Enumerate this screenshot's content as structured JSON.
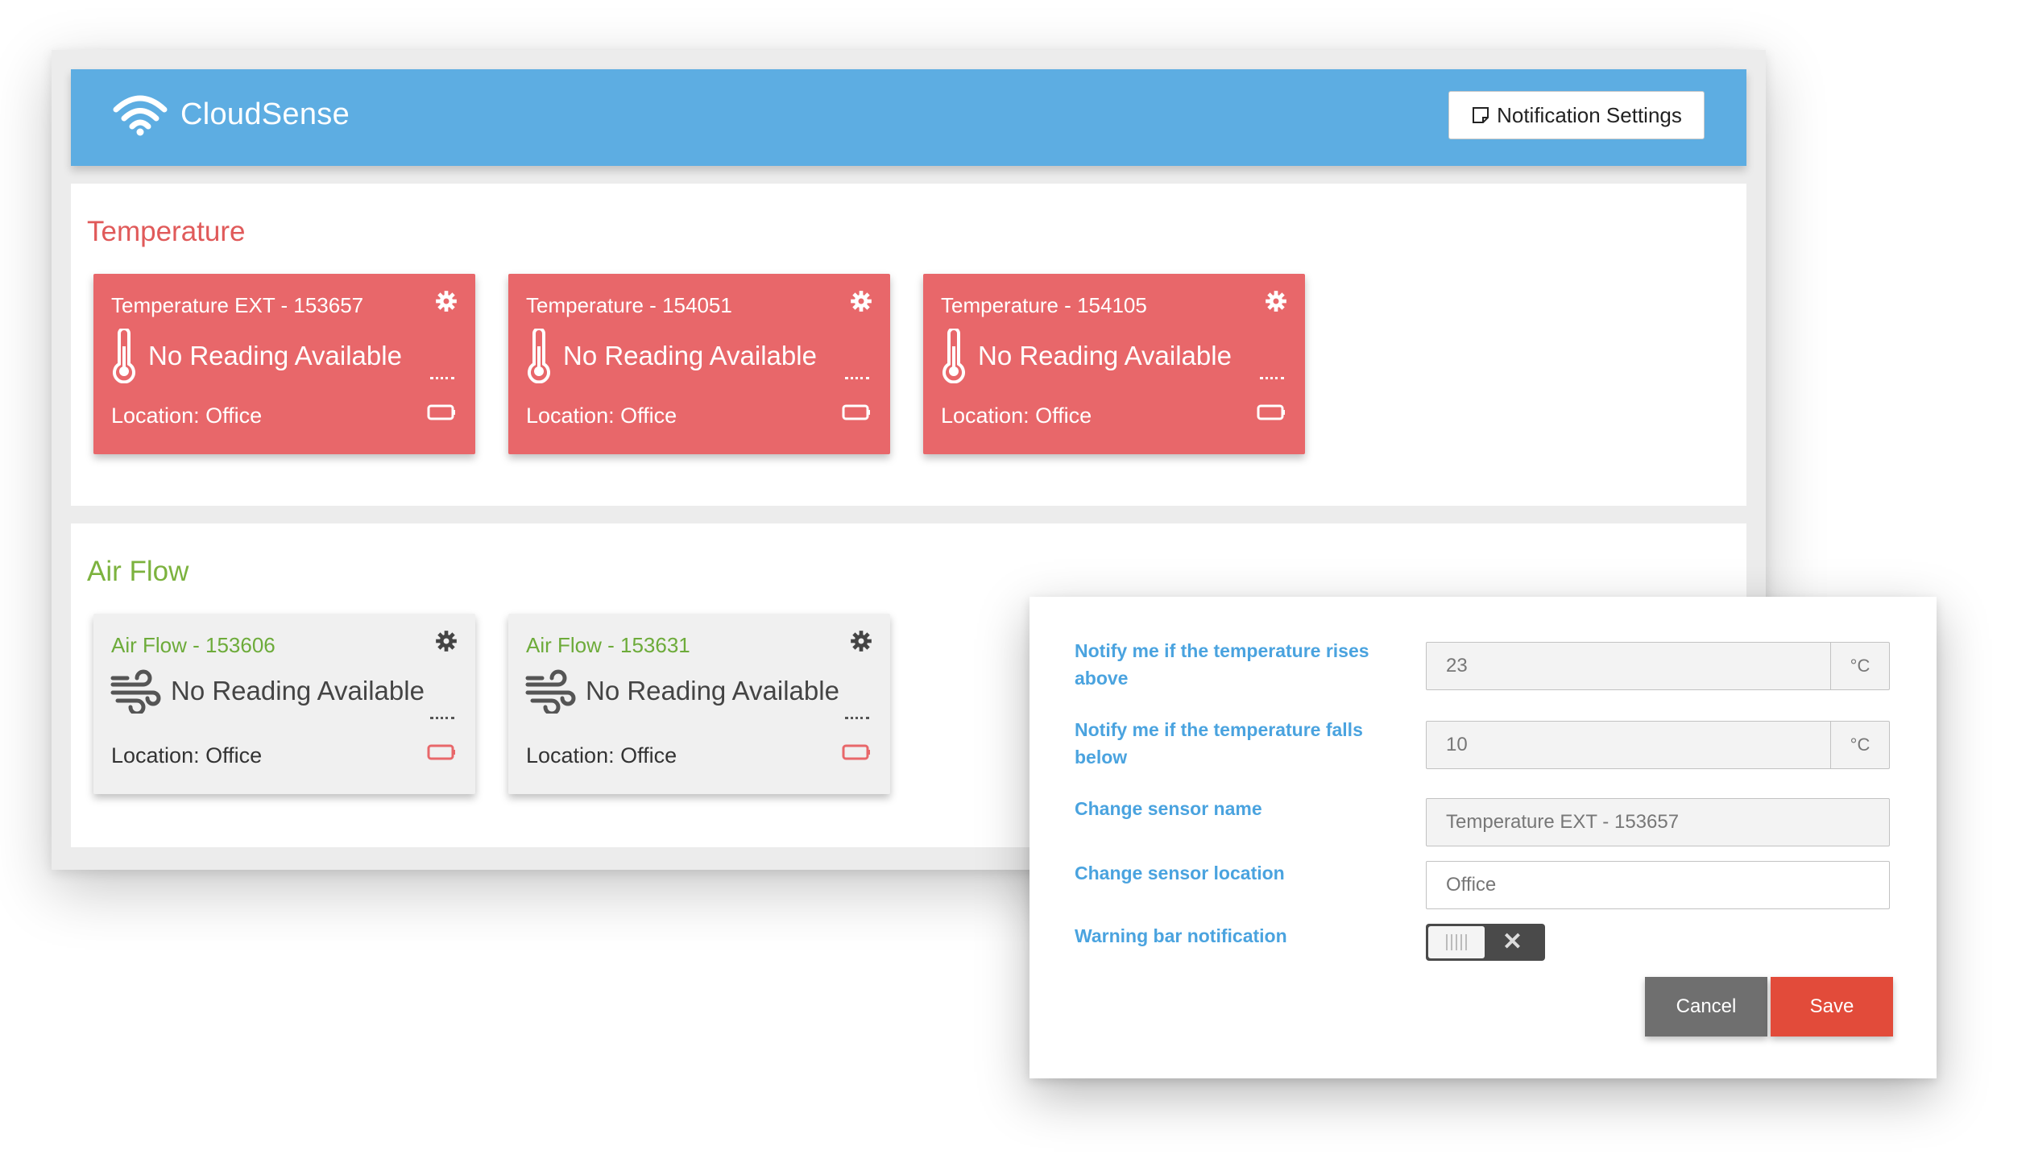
{
  "app": {
    "brand": "CloudSense",
    "notification_button": "Notification Settings"
  },
  "sections": {
    "temperature": {
      "title": "Temperature",
      "color": "#e05a5a",
      "cards": [
        {
          "title": "Temperature EXT - 153657",
          "reading": "No Reading Available",
          "location": "Location: Office"
        },
        {
          "title": "Temperature - 154051",
          "reading": "No Reading Available",
          "location": "Location: Office"
        },
        {
          "title": "Temperature - 154105",
          "reading": "No Reading Available",
          "location": "Location: Office"
        }
      ]
    },
    "airflow": {
      "title": "Air Flow",
      "color": "#7cb23e",
      "cards": [
        {
          "title": "Air Flow - 153606",
          "reading": "No Reading Available",
          "location": "Location: Office"
        },
        {
          "title": "Air Flow - 153631",
          "reading": "No Reading Available",
          "location": "Location: Office"
        }
      ]
    }
  },
  "dialog": {
    "rise_label": "Notify me if the temperature rises above",
    "rise_value": "23",
    "rise_unit": "°C",
    "fall_label": "Notify me if the temperature falls below",
    "fall_value": "10",
    "fall_unit": "°C",
    "name_label": "Change sensor name",
    "name_value": "Temperature EXT - 153657",
    "location_label": "Change sensor location",
    "location_value": "Office",
    "warning_label": "Warning bar notification",
    "warning_enabled": false,
    "cancel": "Cancel",
    "save": "Save"
  },
  "colors": {
    "header": "#5dade2",
    "temperature_card": "#e8676a",
    "airflow_card": "#f0f0f0",
    "label_blue": "#4aa3df",
    "save": "#e24b3a",
    "cancel": "#6f6f6f"
  },
  "icons": [
    "wifi-icon",
    "note-icon",
    "gear-icon",
    "thermometer-icon",
    "wind-icon",
    "battery-icon"
  ]
}
